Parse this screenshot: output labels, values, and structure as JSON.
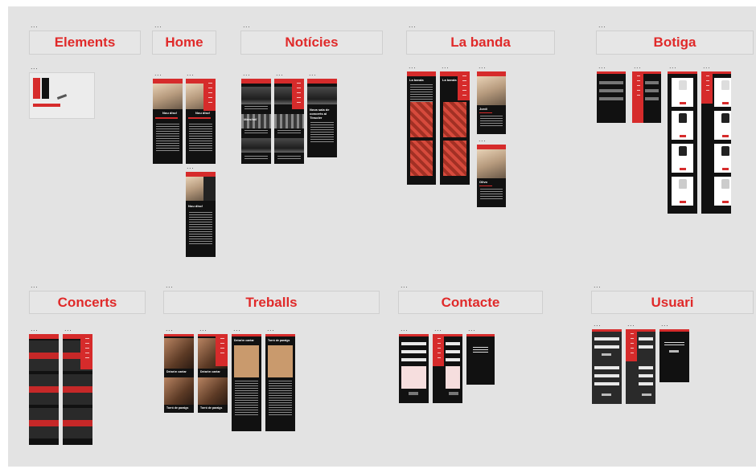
{
  "canvas": {
    "background": "#e3e3e3",
    "accent": "#e02a2a",
    "frame_dark": "#111111",
    "overflow_menu_icon": "ellipsis-icon"
  },
  "overflow_label": "...",
  "sections": {
    "elements": {
      "title": "Elements"
    },
    "home": {
      "title": "Home"
    },
    "noticies": {
      "title": "Notícies"
    },
    "la_banda": {
      "title": "La banda"
    },
    "botiga": {
      "title": "Botiga"
    },
    "concerts": {
      "title": "Concerts"
    },
    "treballs": {
      "title": "Treballs"
    },
    "contacte": {
      "title": "Contacte"
    },
    "usuari": {
      "title": "Usuari"
    }
  },
  "frames": {
    "home_headline": "Nou disc!",
    "banda_title": "La banda",
    "member_1": "Jordi",
    "member_2": "Olivo",
    "noticies_card": "Nova sala de concerts al Tinsoler",
    "noticies_brand": "Marshall",
    "treballs_title": "Deixa'm cantar",
    "treballs_title_2": "Torró de paraigs"
  }
}
